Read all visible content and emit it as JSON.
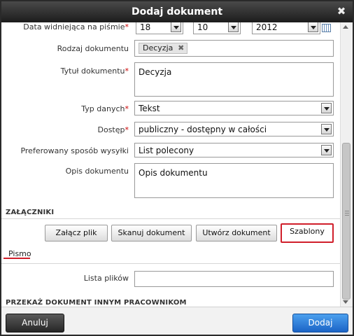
{
  "dialog": {
    "title": "Dodaj dokument",
    "close_icon": "close-icon"
  },
  "form": {
    "date_label": "Data widniejąca na piśmie",
    "date_day": "18",
    "date_month": "10",
    "date_year": "2012",
    "doc_type_label": "Rodzaj dokumentu",
    "doc_type_tag": "Decyzja",
    "title_label": "Tytuł dokumentu",
    "title_value": "Decyzja",
    "data_type_label": "Typ danych",
    "data_type_value": "Tekst",
    "access_label": "Dostęp",
    "access_value": "publiczny - dostępny w całości",
    "shipping_label": "Preferowany sposób wysyłki",
    "shipping_value": "List polecony",
    "description_label": "Opis dokumentu",
    "description_value": "Opis dokumentu",
    "required_marker": "*"
  },
  "attachments": {
    "section_title": "ZAŁĄCZNIKI",
    "buttons": {
      "attach_file": "Załącz plik",
      "scan_document": "Skanuj dokument",
      "create_document": "Utwórz dokument",
      "templates": "Szablony"
    },
    "tab_pismo": "Pismo",
    "file_list_label": "Lista plików"
  },
  "forward_section": {
    "title": "PRZEKAŻ DOKUMENT INNYM PRACOWNIKOM"
  },
  "footer": {
    "cancel_label": "Anuluj",
    "add_label": "Dodaj"
  },
  "colors": {
    "highlight_border": "#d01f2b",
    "primary_button": "#1c64c6",
    "titlebar": "#2a2a2a"
  }
}
